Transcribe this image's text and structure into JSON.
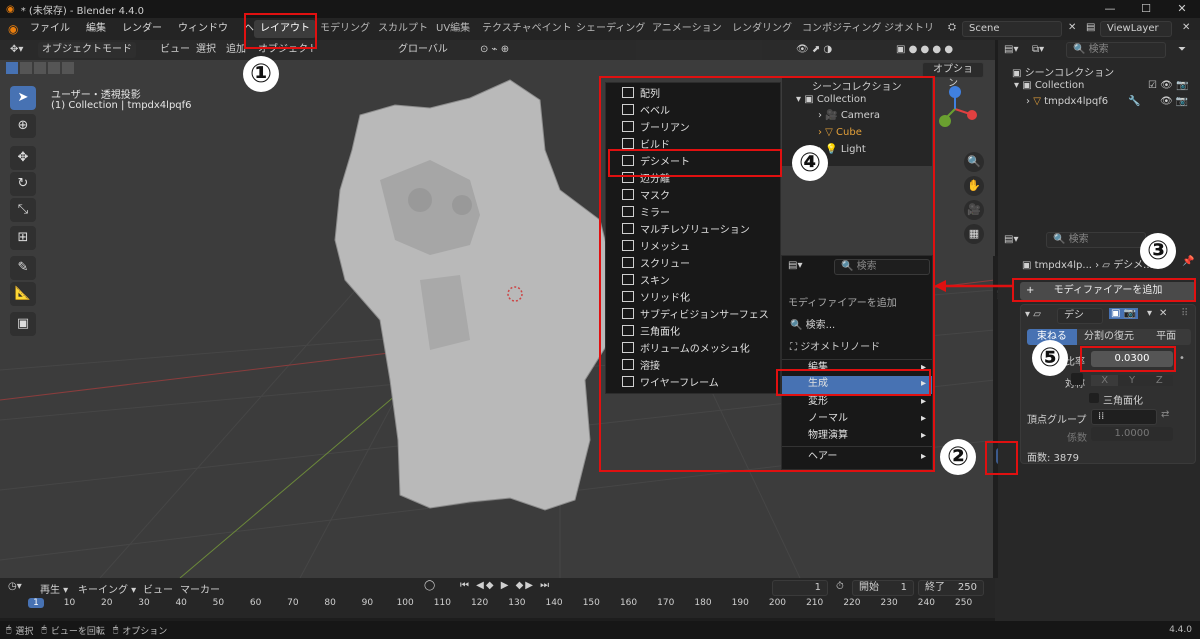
{
  "title": "* (未保存) - Blender 4.4.0",
  "menu": [
    "ファイル",
    "編集",
    "レンダー",
    "ウィンドウ",
    "ヘルプ"
  ],
  "workspaces": [
    "レイアウト",
    "モデリング",
    "スカルプト",
    "UV編集",
    "テクスチャペイント",
    "シェーディング",
    "アニメーション",
    "レンダリング",
    "コンポジティング",
    "ジオメトリ"
  ],
  "scene": "Scene",
  "viewlayer": "ViewLayer",
  "vp_header": {
    "mode": "オブジェクトモード",
    "view": "ビュー",
    "select": "選択",
    "add": "追加",
    "object": "オブジェクト",
    "orient": "グローバル",
    "options": "オプション"
  },
  "vp_info": {
    "line1": "ユーザー・透視投影",
    "line2": "(1) Collection | tmpdx4lpqf6"
  },
  "scene_overlay": {
    "title": "シーンコレクション",
    "collection": "Collection",
    "items": [
      "Camera",
      "Cube",
      "Light"
    ]
  },
  "submenu_generate": [
    "配列",
    "ベベル",
    "ブーリアン",
    "ビルド",
    "デシメート",
    "辺分離",
    "マスク",
    "ミラー",
    "マルチレゾリューション",
    "リメッシュ",
    "スクリュー",
    "スキン",
    "ソリッド化",
    "サブディビジョンサーフェス",
    "三角面化",
    "ボリュームのメッシュ化",
    "溶接",
    "ワイヤーフレーム"
  ],
  "add_menu": {
    "search_placeholder": "検索",
    "title": "モディファイアーを追加",
    "search": "検索...",
    "geonodes": "ジオメトリノード",
    "items": [
      "編集",
      "生成",
      "変形",
      "ノーマル",
      "物理演算",
      "ヘアー"
    ]
  },
  "outliner": {
    "search_placeholder": "検索",
    "root": "シーンコレクション",
    "collection": "Collection",
    "object": "tmpdx4lpqf6"
  },
  "props": {
    "search_placeholder": "検索",
    "breadcrumb_obj": "tmpdx4lp...",
    "breadcrumb_mod": "デシメ...",
    "add_button": "モディファイアーを追加",
    "mod_name": "デシメ...",
    "tabs": [
      "束ねる",
      "分割の復元",
      "平面"
    ],
    "ratio_label": "比率",
    "ratio_value": "0.0300",
    "symmetry_label": "対称",
    "axes": [
      "X",
      "Y",
      "Z"
    ],
    "triangulate": "三角面化",
    "vgroup_label": "頂点グループ",
    "factor_label": "係数",
    "factor_value": "1.0000",
    "face_count": "面数: 3879"
  },
  "timeline": {
    "playback": "再生",
    "keying": "キーイング",
    "view": "ビュー",
    "marker": "マーカー",
    "frame": "1",
    "start_label": "開始",
    "start": "1",
    "end_label": "終了",
    "end": "250",
    "ticks": [
      "1",
      "10",
      "20",
      "30",
      "40",
      "50",
      "60",
      "70",
      "80",
      "90",
      "100",
      "110",
      "120",
      "130",
      "140",
      "150",
      "160",
      "170",
      "180",
      "190",
      "200",
      "210",
      "220",
      "230",
      "240",
      "250"
    ]
  },
  "status": {
    "select": "選択",
    "rotate": "ビューを回転",
    "options": "オプション",
    "version": "4.4.0"
  },
  "steps": [
    "①",
    "②",
    "③",
    "④",
    "⑤"
  ],
  "colors": {
    "annotation_red": "#e01010",
    "accent_blue": "#4772b3",
    "cube_orange": "#e3a03a"
  }
}
